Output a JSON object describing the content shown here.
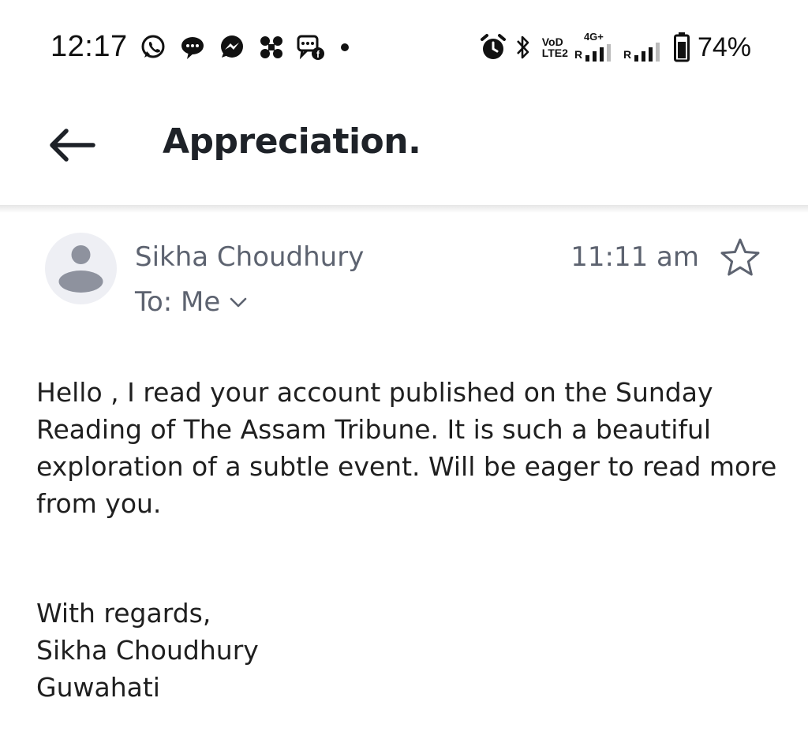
{
  "status_bar": {
    "time": "12:17",
    "notification_icons": [
      "whatsapp-icon",
      "chat-bubble-icon",
      "messenger-icon",
      "app-grid-icon",
      "sms-icon",
      "more-notifications-dot-icon"
    ],
    "system_icons": [
      "alarm-icon",
      "bluetooth-icon",
      "volte-icon",
      "signal-4g-icon",
      "signal-sim2-icon",
      "battery-icon"
    ],
    "volte_label_top": "VoD",
    "volte_label_bottom": "LTE2",
    "network_type": "4G+",
    "roaming_1": "R",
    "roaming_2": "R",
    "battery_percent": "74%"
  },
  "app_bar": {
    "back_icon": "back-arrow-icon",
    "subject": "Appreciation."
  },
  "message": {
    "sender": "Sikha Choudhury",
    "recipient_label": "To: Me",
    "time": "11:11 am",
    "avatar_icon": "person-avatar-icon",
    "star_icon": "star-outline-icon",
    "expand_icon": "chevron-down-icon",
    "body": "Hello , I read your account published on the Sunday Reading of The Assam Tribune. It is such a beautiful exploration of a subtle event. Will be eager to read more from you.",
    "signature": [
      "With regards,",
      "Sikha Choudhury",
      "Guwahati"
    ]
  },
  "colors": {
    "background": "#ffffff",
    "subject_text": "#1e2228",
    "meta_text": "#5d6370",
    "body_text": "#1f1f1f",
    "avatar_bg": "#eeeff4",
    "avatar_fg": "#8e929e"
  }
}
